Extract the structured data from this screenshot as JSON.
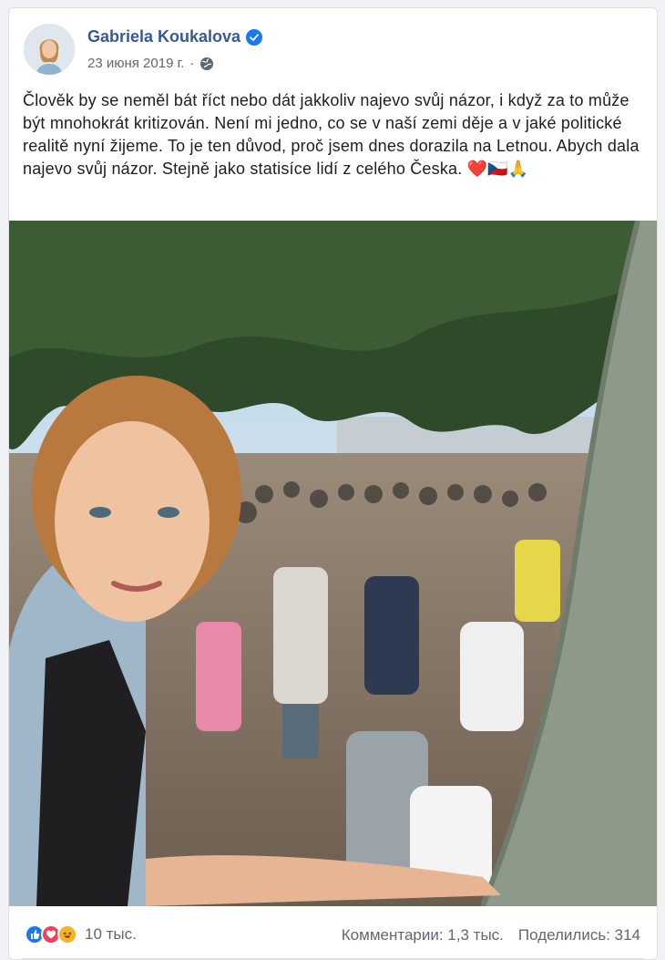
{
  "post": {
    "author": "Gabriela Koukalova",
    "date": "23 июня 2019 г.",
    "separator": "·",
    "text": "Člověk by se neměl bát říct nebo dát jakkoliv najevo svůj názor, i když za to může být mnohokrát kritizován. Není mi jedno, co se v naší zemi děje a v jaké politické realitě nyní žijeme. To je ten důvod, proč jsem dnes dorazila na Letnou. Abych dala najevo svůj názor. Stejně jako statisíce lidí z celého Česka.",
    "emojis": "❤️🇨🇿🙏"
  },
  "footer": {
    "reaction_count": "10 тыс.",
    "comments": "Комментарии: 1,3 тыс.",
    "shares": "Поделились: 314"
  },
  "icons": {
    "verified": "verified-badge-icon",
    "audience": "globe-icon",
    "reactions": [
      "like-icon",
      "love-icon",
      "haha-icon"
    ]
  },
  "colors": {
    "author_link": "#385898",
    "verified": "#1877f2",
    "like": "#1877f2",
    "love": "#f33e58",
    "haha": "#f7b125"
  }
}
